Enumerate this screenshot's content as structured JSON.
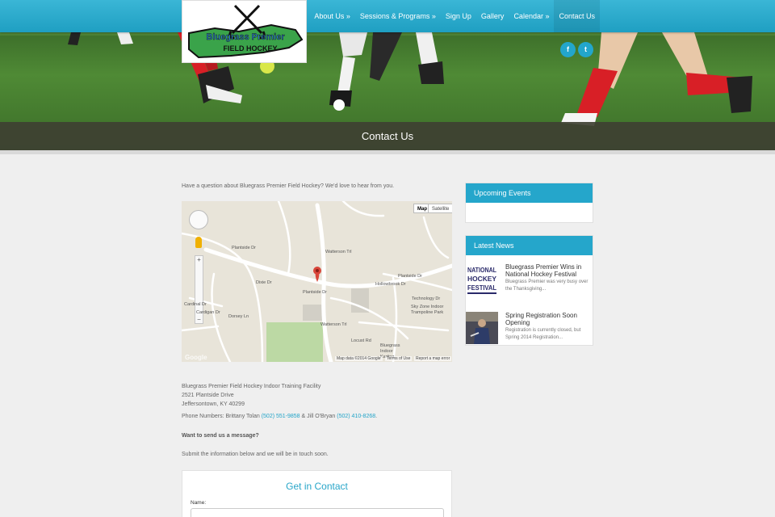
{
  "nav": {
    "items": [
      {
        "label": "About Us »"
      },
      {
        "label": "Sessions & Programs »"
      },
      {
        "label": "Sign Up"
      },
      {
        "label": "Gallery"
      },
      {
        "label": "Calendar »"
      },
      {
        "label": "Contact Us"
      }
    ]
  },
  "logo": {
    "line1": "Bluegrass Premier",
    "line2": "FIELD HOCKEY"
  },
  "social": {
    "facebook": "f",
    "twitter": "t",
    "facebook_icon": "facebook-icon",
    "twitter_icon": "twitter-icon"
  },
  "page_title": "Contact Us",
  "intro": "Have a question about Bluegrass Premier Field Hockey? We'd love to hear from you.",
  "map": {
    "map_label": "Map",
    "satellite_label": "Satellite",
    "streets": [
      "Plantside Dr",
      "Plantside Dr",
      "Plantside Dr",
      "Watterson Trl",
      "Watterson Trl",
      "Locust Rd",
      "Technology Dr",
      "Dixie Dr",
      "Cardinal Dr",
      "Cardigan Dr",
      "Dorsey Ln",
      "Hollowbrook Dr",
      "Sky Zone Indoor Trampoline Park",
      "Bluegrass Indoor Karting"
    ],
    "footer_data": "Map data ©2014 Google",
    "footer_terms": "Terms of Use",
    "footer_report": "Report a map error",
    "google_mark": "Google"
  },
  "address": {
    "line1": "Bluegrass Premier Field Hockey Indoor Training Facility",
    "line2": "2521 Plantside Drive",
    "line3": "Jeffersontown, KY 40299"
  },
  "phones": {
    "prefix": "Phone Numbers: Brittany Tolan ",
    "phone1": "(502) 551-9858",
    "mid": " & Jill O'Bryan ",
    "phone2": "(502) 410-8268",
    "suffix": "."
  },
  "message": {
    "heading": "Want to send us a message?",
    "sub": "Submit the information below and we will be in touch soon."
  },
  "form": {
    "title": "Get in Contact",
    "name_label": "Name:",
    "name_value": ""
  },
  "sidebar": {
    "events_title": "Upcoming Events",
    "news_title": "Latest News",
    "news": [
      {
        "title": "Bluegrass Premier Wins in National Hockey Festival",
        "excerpt": "Bluegrass Premier was very busy over the Thanksgiving...",
        "thumb_text": "NATIONAL HOCKEY FESTIVAL"
      },
      {
        "title": "Spring Registration Soon Opening",
        "excerpt": "Registration is currently closed, but Spring 2014 Registration..."
      }
    ]
  },
  "colors": {
    "accent": "#25a6cb",
    "nav_bar": "#2aaad0",
    "link": "#22a4c8"
  }
}
